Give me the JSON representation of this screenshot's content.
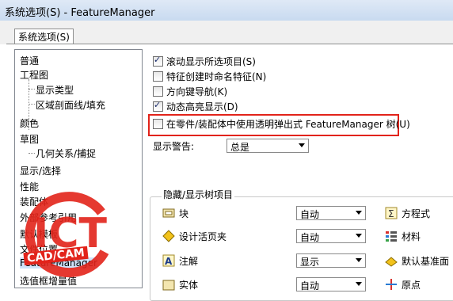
{
  "window": {
    "title": "系统选项(S) - FeatureManager"
  },
  "tabs": [
    {
      "label": "系统选项(S)"
    }
  ],
  "tree": {
    "items": [
      {
        "label": "普通"
      },
      {
        "label": "工程图"
      },
      {
        "label": "显示类型"
      },
      {
        "label": "区域剖面线/填充"
      },
      {
        "label": "颜色"
      },
      {
        "label": "草图"
      },
      {
        "label": "几何关系/捕捉"
      },
      {
        "label": "显示/选择"
      },
      {
        "label": "性能"
      },
      {
        "label": "装配体"
      },
      {
        "label": "外部参考引用"
      },
      {
        "label": "默认模板"
      },
      {
        "label": "文件位置"
      },
      {
        "label": "FeatureManager"
      },
      {
        "label": "选值框增量值"
      }
    ]
  },
  "options": {
    "checkboxes": [
      {
        "label": "滚动显示所选项目(S)",
        "checked": true
      },
      {
        "label": "特征创建时命名特征(N)",
        "checked": false
      },
      {
        "label": "方向键导航(K)",
        "checked": false
      },
      {
        "label": "动态高亮显示(D)",
        "checked": true
      },
      {
        "label": "在零件/装配体中使用透明弹出式 FeatureManager 树(U)",
        "checked": false
      }
    ],
    "warning_label": "显示警告:",
    "warning_value": "总是"
  },
  "hide_show": {
    "title": "隐藏/显示树项目",
    "rows": [
      {
        "icon": "block-icon",
        "label": "块",
        "value": "自动",
        "right_icon": "equation-icon",
        "right_label": "方程式"
      },
      {
        "icon": "design-binder-icon",
        "label": "设计活页夹",
        "value": "自动",
        "right_icon": "material-icon",
        "right_label": "材料"
      },
      {
        "icon": "annotation-icon",
        "label": "注解",
        "value": "显示",
        "right_icon": "default-planes-icon",
        "right_label": "默认基准面"
      },
      {
        "icon": "solid-bodies-icon",
        "label": "实体",
        "value": "自动",
        "right_icon": "origin-icon",
        "right_label": "原点"
      }
    ]
  },
  "watermark": {
    "text": "ICT",
    "badge": "CAD/CAM",
    "colors": {
      "red": "#e2231a"
    }
  },
  "colors": {
    "highlight": "#e2231a",
    "titlebar": "#c8daf0"
  }
}
